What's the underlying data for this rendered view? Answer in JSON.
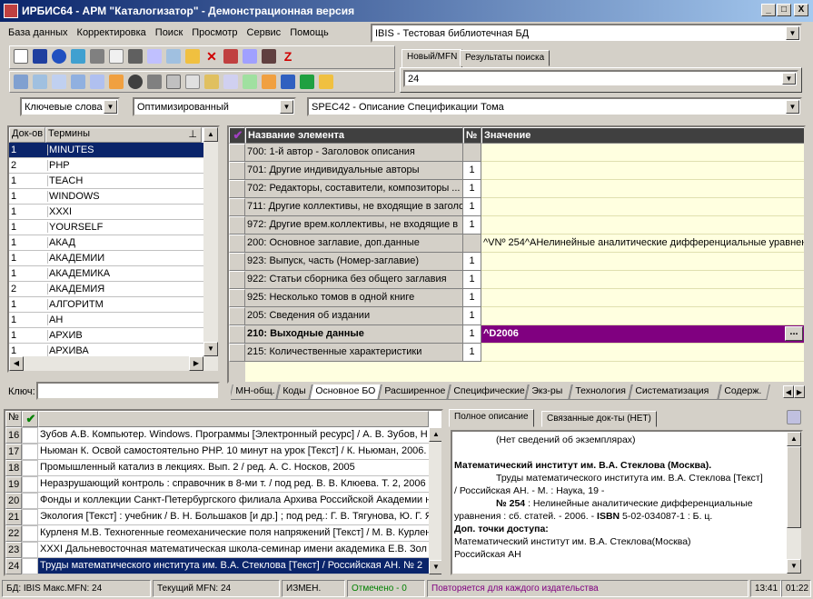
{
  "window": {
    "title": "ИРБИС64 - АРМ \"Каталогизатор\" - Демонстрационная версия",
    "min": "_",
    "max": "□",
    "close": "X"
  },
  "menu": [
    "База данных",
    "Корректировка",
    "Поиск",
    "Просмотр",
    "Сервис",
    "Помощь"
  ],
  "db_combo": {
    "value": "IBIS - Тестовая библиотечная БД"
  },
  "right_tabs": [
    "Новый/MFN",
    "Результаты поиска"
  ],
  "mfn_combo": {
    "value": "24"
  },
  "filters": {
    "kind": "Ключевые слова",
    "mode": "Оптимизированный",
    "worksheet": "SPEC42 - Описание Спецификации Тома"
  },
  "dict": {
    "headers": [
      "Док-ов",
      "Термины"
    ],
    "rows": [
      [
        "1",
        "MINUTES"
      ],
      [
        "2",
        "PHP"
      ],
      [
        "1",
        "TEACH"
      ],
      [
        "1",
        "WINDOWS"
      ],
      [
        "1",
        "XXXI"
      ],
      [
        "1",
        "YOURSELF"
      ],
      [
        "1",
        "АКАД"
      ],
      [
        "1",
        "АКАДЕМИИ"
      ],
      [
        "1",
        "АКАДЕМИКА"
      ],
      [
        "2",
        "АКАДЕМИЯ"
      ],
      [
        "1",
        "АЛГОРИТМ"
      ],
      [
        "1",
        "АН"
      ],
      [
        "1",
        "АРХИВ"
      ],
      [
        "1",
        "АРХИВА"
      ]
    ],
    "key_label": "Ключ:"
  },
  "fields": {
    "headers": [
      "Название элемента",
      "№",
      "Значение"
    ],
    "rows": [
      {
        "name": "700: 1-й автор - Заголовок описания",
        "num": "",
        "value": ""
      },
      {
        "name": "701: Другие индивидуальные авторы",
        "num": "1",
        "value": ""
      },
      {
        "name": "702: Редакторы, составители, композиторы ...",
        "num": "1",
        "value": ""
      },
      {
        "name": "711: Другие коллективы, не входящие в заголо",
        "num": "1",
        "value": ""
      },
      {
        "name": "972: Другие врем.коллективы, не входящие в",
        "num": "1",
        "value": ""
      },
      {
        "name": "200: Основное заглавие, доп.данные",
        "num": "",
        "value": "^VNº 254^AНелинейные аналитические дифференциальные уравнен"
      },
      {
        "name": "923: Выпуск, часть (Номер-заглавие)",
        "num": "1",
        "value": ""
      },
      {
        "name": "922: Статьи сборника без общего заглавия",
        "num": "1",
        "value": ""
      },
      {
        "name": "925: Несколько томов в одной книге",
        "num": "1",
        "value": ""
      },
      {
        "name": "205: Сведения об издании",
        "num": "1",
        "value": ""
      },
      {
        "name": "210: Выходные данные",
        "num": "1",
        "value": "^D2006"
      },
      {
        "name": "215: Количественные характеристики",
        "num": "1",
        "value": ""
      }
    ],
    "ellipsis": "..."
  },
  "bottom_tabs": [
    "МН-общ.",
    "Коды",
    "Основное БО",
    "Расширенное",
    "Специфические",
    "Экз-ры",
    "Технология",
    "Систематизация",
    "Содерж."
  ],
  "records": {
    "headers": [
      "№",
      "✔"
    ],
    "rows": [
      {
        "n": "16",
        "text": "Зубов А.В. Компьютер. Windows. Программы [Электронный ресурс] / А. В. Зубов, Н"
      },
      {
        "n": "17",
        "text": "Ньюман К. Освой самостоятельно PHP. 10 минут на урок [Текст] / К. Ньюман, 2006."
      },
      {
        "n": "18",
        "text": "Промышленный катализ в лекциях. Вып. 2 / ред. А. С. Носков, 2005"
      },
      {
        "n": "19",
        "text": "Неразрушающий контроль : справочник в 8-ми т. / под ред. В. В. Клюева. Т. 2, 2006"
      },
      {
        "n": "20",
        "text": "Фонды и коллекции Санкт-Петербургского филиала Архива Российской Академии н"
      },
      {
        "n": "21",
        "text": "Экология [Текст] : учебник / В. Н. Большаков [и др.] ; под ред.: Г. В. Тягунова, Ю. Г. Я"
      },
      {
        "n": "22",
        "text": "Курленя М.В. Техногенные геомеханические поля напряжений [Текст] / М. В. Курлен"
      },
      {
        "n": "23",
        "text": "XXXI Дальневосточная математическая школа-семинар имени академика Е.В. Зол"
      },
      {
        "n": "24",
        "text": "Труды математического института им. В.А. Стеклова [Текст] / Российская АН. № 2"
      }
    ]
  },
  "desc_tabs": [
    "Полное описание",
    "Связанные док-ты (НЕТ)"
  ],
  "desc": {
    "line1": "(Нет сведений об экземплярах)",
    "line2": "Математический институт им. В.А. Стеклова (Москва).",
    "line3a": "Труды математического института им. В.А. Стеклова [Текст]",
    "line3b": "/ Российская АН. - М. : Наука, 19 -",
    "line4a_b": "№ 254",
    "line4a": " : Нелинейные аналитические дифференциальные",
    "line4b": "уравнения : сб. статей. - 2006. - ",
    "line4b_isbn": "ISBN",
    "line4b_rest": " 5-02-034087-1 : Б. ц.",
    "line5": "Доп. точки доступа:",
    "line6": "Математический институт им. В.А. Стеклова(Москва)",
    "line7": "Российская АН"
  },
  "status": {
    "db": "БД: IBIS Макс.MFN: 24",
    "cur": "Текущий MFN: 24",
    "changed": "ИЗМЕН.",
    "marked": "Отмечено - 0",
    "repeat": "Повторяется для каждого издательства",
    "time": "13:41",
    "time2": "01:22"
  },
  "colors": {
    "title_start": "#0a246a",
    "title_end": "#a6caf0",
    "select": "#0a246a",
    "field_value_bg": "#ffffe0",
    "purple": "#800080",
    "green": "#008000",
    "magenta": "#800080"
  }
}
